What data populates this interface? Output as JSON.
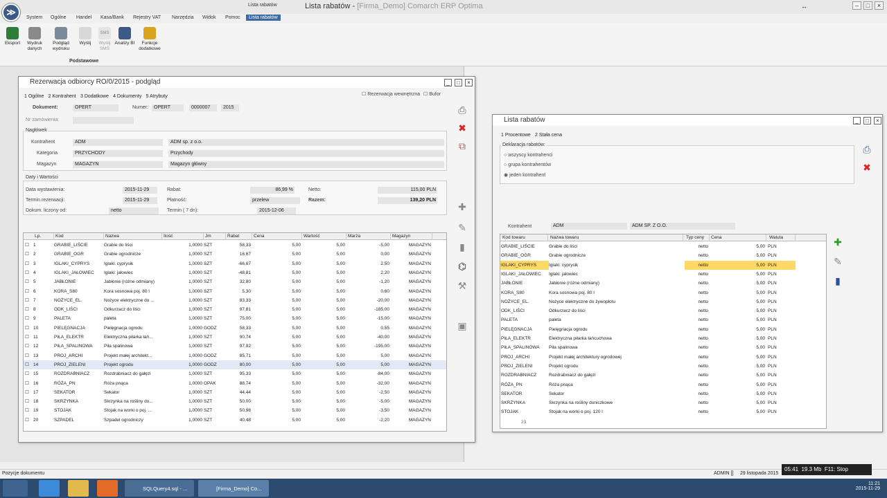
{
  "app": {
    "title": "Lista rabatów",
    "subtitle": "[Firma_Demo] Comarch ERP Optima",
    "context_tab": "Lista rabatów",
    "logo": "erp-logo-icon"
  },
  "menu": [
    "System",
    "Ogólne",
    "Handel",
    "Kasa/Bank",
    "Rejestry VAT",
    "Narzędzia",
    "Widok",
    "Pomoc",
    "Lista rabatów"
  ],
  "ribbon": {
    "buttons": [
      {
        "label": "Eksport",
        "icon": "export-icon"
      },
      {
        "label": "Wydruk danych",
        "icon": "print-icon"
      },
      {
        "label": "Podgląd wydruku",
        "icon": "print-preview-icon"
      },
      {
        "label": "Wyślij",
        "icon": "send-icon"
      },
      {
        "label": "Wyślij SMS",
        "icon": "sms-icon"
      },
      {
        "label": "Analizy BI",
        "icon": "bi-icon"
      },
      {
        "label": "Funkcje dodatkowe",
        "icon": "extra-functions-icon"
      }
    ],
    "group": "Podstawowe"
  },
  "reservation": {
    "title": "Rezerwacja odbiorcy RO/0/2015 - podgląd",
    "tabs": [
      "1 Ogólne",
      "2 Kontrahent",
      "3 Dodatkowe",
      "4 Dokumenty",
      "5 Atrybuty"
    ],
    "chk_internal": "Rezerwacja wewnętrzna",
    "chk_bufor": "Bufor",
    "dokument_label": "Dokument:",
    "dokument": "OPERT",
    "numer_label": "Numer:",
    "numer_prefix": "OPERT",
    "numer": "0000007",
    "rok": "2015",
    "nr_zam_label": "Nr zamówienia:",
    "naglowek": "Nagłówek",
    "kontrahent_label": "Kontrahent",
    "kontrahent": "ADM",
    "kontrahent_name": "ADM sp. z o.o.",
    "kategoria_label": "Kategoria",
    "kategoria": "PRZYCHODY",
    "kategoria_name": "Przychody",
    "magazyn_label": "Magazyn",
    "magazyn": "MAGAZYN",
    "magazyn_name": "Magazyn główny",
    "daty": "Daty i Wartości",
    "data_wyst_label": "Data wystawienia:",
    "data_wyst": "2015-11-29",
    "termin_rez_label": "Termin rezerwacji:",
    "termin_rez": "2015-11-29",
    "dokum_label": "Dokum. liczony od:",
    "dokum": "netto",
    "rabat_label": "Rabat:",
    "rabat": "86,99 %",
    "platnosc_label": "Płatność:",
    "platnosc": "przelew",
    "termin_label": "Termin ( 7 dn):",
    "termin": "2015-12-06",
    "netto_label": "Netto:",
    "netto": "115,00 PLN",
    "razem_label": "Razem:",
    "razem": "139,20 PLN",
    "columns": [
      "Lp.",
      "Kod",
      "Nazwa",
      "Ilość",
      "Jm",
      "Rabat",
      "Cena",
      "Wartość",
      "Marża",
      "Magazyn"
    ],
    "rows": [
      [
        "1",
        "GRABIE_LIŚCIE",
        "Grabie do liści",
        "1,0000",
        "SZT",
        "58,33",
        "5,00",
        "5,00",
        "-5,00",
        "MAGAZYN"
      ],
      [
        "2",
        "GRABIE_OGR",
        "Grabie ogrodnicze",
        "1,0000",
        "SZT",
        "16,67",
        "5,00",
        "5,00",
        "0,00",
        "MAGAZYN"
      ],
      [
        "3",
        "IGLAKI_CYPRYS",
        "Iglaki: cyprysik",
        "1,0000",
        "SZT",
        "-66,67",
        "5,00",
        "5,00",
        "2,50",
        "MAGAZYN"
      ],
      [
        "4",
        "IGLAKI_JAŁOWIEC",
        "Iglaki: jałowiec",
        "1,0000",
        "SZT",
        "-48,81",
        "5,00",
        "5,00",
        "2,20",
        "MAGAZYN"
      ],
      [
        "5",
        "JABŁONIE",
        "Jabłonie (różne odmiany)",
        "1,0000",
        "SZT",
        "32,80",
        "5,00",
        "5,00",
        "-1,20",
        "MAGAZYN"
      ],
      [
        "6",
        "KORA_S80",
        "Kora sosnowa poj. 80 l",
        "1,0000",
        "SZT",
        "5,30",
        "5,00",
        "5,00",
        "0,60",
        "MAGAZYN"
      ],
      [
        "7",
        "NOŻYCE_EL.",
        "Nożyce elektryczne do ...",
        "1,0000",
        "SZT",
        "83,33",
        "5,00",
        "5,00",
        "-20,00",
        "MAGAZYN"
      ],
      [
        "8",
        "ODK_LIŚCI",
        "Odkurzacz do liści",
        "1,0000",
        "SZT",
        "97,81",
        "5,00",
        "5,00",
        "-185,00",
        "MAGAZYN"
      ],
      [
        "9",
        "PALETA",
        "paleta",
        "1,0000",
        "SZT",
        "75,00",
        "5,00",
        "5,00",
        "-15,00",
        "MAGAZYN"
      ],
      [
        "10",
        "PIELĘGNACJA",
        "Pielęgnacja ogrodu",
        "1,0000",
        "GODZ",
        "58,33",
        "5,00",
        "5,00",
        "0,55",
        "MAGAZYN"
      ],
      [
        "11",
        "PIŁA_ELEKTR",
        "Elektryczna piłarka łań...",
        "1,0000",
        "SZT",
        "90,74",
        "5,00",
        "5,00",
        "-40,00",
        "MAGAZYN"
      ],
      [
        "12",
        "PIŁA_SPALINOWA",
        "Piła spalinowa",
        "1,0000",
        "SZT",
        "97,92",
        "5,00",
        "5,00",
        "-195,00",
        "MAGAZYN"
      ],
      [
        "13",
        "PROJ_ARCHI",
        "Projekt małej architekt...",
        "1,0000",
        "GODZ",
        "85,71",
        "5,00",
        "5,00",
        "5,00",
        "MAGAZYN"
      ],
      [
        "14",
        "PROJ_ZIELENI",
        "Projekt ogrodu",
        "1,0000",
        "GODZ",
        "80,00",
        "5,00",
        "5,00",
        "5,00",
        "MAGAZYN"
      ],
      [
        "15",
        "ROZDRABNIACZ",
        "Rozdrabniacz do gałęzi",
        "1,0000",
        "SZT",
        "95,33",
        "5,00",
        "5,00",
        "-84,00",
        "MAGAZYN"
      ],
      [
        "16",
        "RÓŻA_PN",
        "Róża pnąca",
        "1,0000",
        "OPAK",
        "88,74",
        "5,00",
        "5,00",
        "-32,00",
        "MAGAZYN"
      ],
      [
        "17",
        "SEKATOR",
        "Sekator",
        "1,0000",
        "SZT",
        "44,44",
        "5,00",
        "5,00",
        "-2,50",
        "MAGAZYN"
      ],
      [
        "18",
        "SKRZYNKA",
        "Skrzynka na rośliny do...",
        "1,0000",
        "SZT",
        "50,00",
        "5,00",
        "5,00",
        "-5,00",
        "MAGAZYN"
      ],
      [
        "19",
        "STOJAK",
        "Stojak na worki o poj. ...",
        "1,0000",
        "SZT",
        "50,98",
        "5,00",
        "5,00",
        "-3,50",
        "MAGAZYN"
      ],
      [
        "20",
        "SZPADEL",
        "Szpadel ogrodniczy",
        "1,0000",
        "SZT",
        "40,48",
        "5,00",
        "5,00",
        "-2,20",
        "MAGAZYN"
      ]
    ]
  },
  "rabaty": {
    "title": "Lista rabatów",
    "tabs": [
      "1 Procentowe",
      "2 Stała cena"
    ],
    "deklaracja": "Deklaracja rabatów:",
    "options": [
      "wszyscy kontrahenci",
      "grupa kontrahentów",
      "jeden kontrahent"
    ],
    "selected_option": "jeden kontrahent",
    "kontrahent_label": "Kontrahent",
    "kontrahent": "ADM",
    "kontrahent_name": "ADM SP. Z O.O.",
    "columns": [
      "Kod towaru",
      "Nazwa towaru",
      "Typ ceny",
      "Cena",
      "Waluta"
    ],
    "rows": [
      [
        "GRABIE_LIŚCIE",
        "Grabie do liści",
        "netto",
        "5,00",
        "PLN"
      ],
      [
        "GRABIE_OGR",
        "Grabie ogrodnicze",
        "netto",
        "5,00",
        "PLN"
      ],
      [
        "IGLAKI_CYPRYS",
        "Iglaki: cyprysik",
        "netto",
        "5,00",
        "PLN"
      ],
      [
        "IGLAKI_JAŁOWIEC",
        "Iglaki: jałowiec",
        "netto",
        "5,00",
        "PLN"
      ],
      [
        "JABŁONIE",
        "Jabłonie (różne odmiany)",
        "netto",
        "5,00",
        "PLN"
      ],
      [
        "KORA_S80",
        "Kora sosnowa poj. 80 l",
        "netto",
        "5,00",
        "PLN"
      ],
      [
        "NOŻYCE_EL.",
        "Nożyce elektryczne do żywopłotu",
        "netto",
        "5,00",
        "PLN"
      ],
      [
        "ODK_LIŚCI",
        "Odkurzacz do liści",
        "netto",
        "5,00",
        "PLN"
      ],
      [
        "PALETA",
        "paleta",
        "netto",
        "5,00",
        "PLN"
      ],
      [
        "PIELĘGNACJA",
        "Pielęgnacja ogrodu",
        "netto",
        "5,00",
        "PLN"
      ],
      [
        "PIŁA_ELEKTR",
        "Elektryczna piłarka łańcuchowa",
        "netto",
        "5,00",
        "PLN"
      ],
      [
        "PIŁA_SPALINOWA",
        "Piła spalinowa",
        "netto",
        "5,00",
        "PLN"
      ],
      [
        "PROJ_ARCHI",
        "Projekt małej architektury ogrodowej",
        "netto",
        "5,00",
        "PLN"
      ],
      [
        "PROJ_ZIELENI",
        "Projekt ogrodu",
        "netto",
        "5,00",
        "PLN"
      ],
      [
        "ROZDRABNIACZ",
        "Rozdrabniacz do gałęzi",
        "netto",
        "5,00",
        "PLN"
      ],
      [
        "RÓŻA_PN",
        "Róża pnąca",
        "netto",
        "5,00",
        "PLN"
      ],
      [
        "SEKATOR",
        "Sekator",
        "netto",
        "5,00",
        "PLN"
      ],
      [
        "SKRZYNKA",
        "Skrzynka na rośliny doniczkowe",
        "netto",
        "5,00",
        "PLN"
      ],
      [
        "STOJAK",
        "Stojak na worki o poj. 120 l",
        "netto",
        "5,00",
        "PLN"
      ]
    ],
    "selected_row": 2,
    "count": "23",
    "highlight": "#ffd966"
  },
  "status": {
    "left": "Pozycje dokumentu",
    "user": "ADMIN []",
    "date": "29 listopada 2015"
  },
  "recorder": {
    "time": "05:41",
    "size": "19.3 Mb",
    "hint": "F11: Stop"
  },
  "taskbar": {
    "items": [
      "SQLQuery4.sql - ...",
      "[Firma_Demo] Co..."
    ],
    "time": "11:21",
    "date": "2015-11-29"
  }
}
